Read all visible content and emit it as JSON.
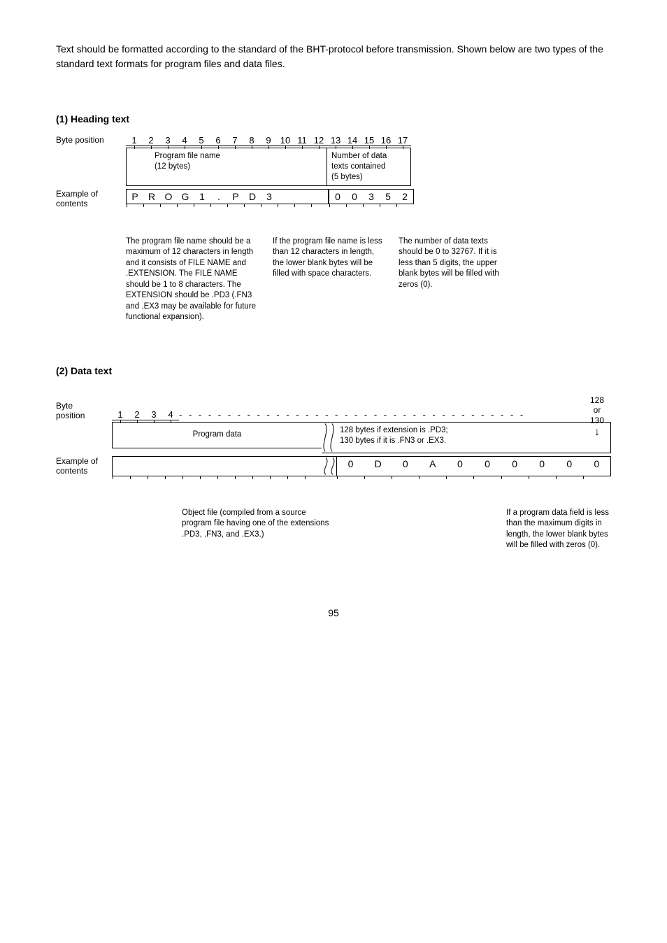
{
  "intro": "Text should be formatted according to the standard of the BHT-protocol before transmission.  Shown below are two types of the standard text formats for program files and data files.",
  "section1": {
    "title": "(1)  Heading text",
    "byte_label": "Byte position",
    "byte_positions": [
      "1",
      "2",
      "3",
      "4",
      "5",
      "6",
      "7",
      "8",
      "9",
      "10",
      "11",
      "12",
      "13",
      "14",
      "15",
      "16",
      "17"
    ],
    "box1_line1": "Program file name",
    "box1_line2": "(12 bytes)",
    "box2_line1": "Number of data",
    "box2_line2": "texts contained",
    "box2_line3": "(5 bytes)",
    "example_label_l1": "Example of",
    "example_label_l2": "contents",
    "example": [
      "P",
      "R",
      "O",
      "G",
      "1",
      ".",
      "P",
      "D",
      "3",
      "",
      "",
      "",
      "0",
      "0",
      "3",
      "5",
      "2"
    ],
    "note1": "The program file name should be a maximum of 12 characters in length and it consists of FILE NAME and .EXTENSION.  The FILE NAME should be 1 to 8 characters.  The EXTENSION should be .PD3 (.FN3 and .EX3 may be available for future functional expansion).",
    "note2": "If the program file name is less than 12 characters in length, the lower blank bytes will be filled with space characters.",
    "note3": "The number of data texts should be 0 to 32767.  If it is less than 5 digits, the upper blank bytes will be filled with zeros (0)."
  },
  "section2": {
    "title": "(2)  Data text",
    "top_right_l1": "128",
    "top_right_l2": "or",
    "top_right_l3": "130",
    "byte_label_l1": "Byte",
    "byte_label_l2": "position",
    "byte_positions": [
      "1",
      "2",
      "3",
      "4"
    ],
    "box_label": "Program data",
    "box_right_l1": "128 bytes if extension is .PD3;",
    "box_right_l2": "130 bytes if it is .FN3 or .EX3.",
    "example_label_l1": "Example of",
    "example_label_l2": "contents",
    "example_tail": [
      "0",
      "D",
      "0",
      "A",
      "0",
      "0",
      "0",
      "0",
      "0",
      "0"
    ],
    "note1": "Object file (compiled from a source program file having one of the extensions .PD3, .FN3, and .EX3.)",
    "note2": "If a program data field is less than the maximum digits in length, the lower blank bytes will be filled with zeros (0)."
  },
  "page_number": "95"
}
